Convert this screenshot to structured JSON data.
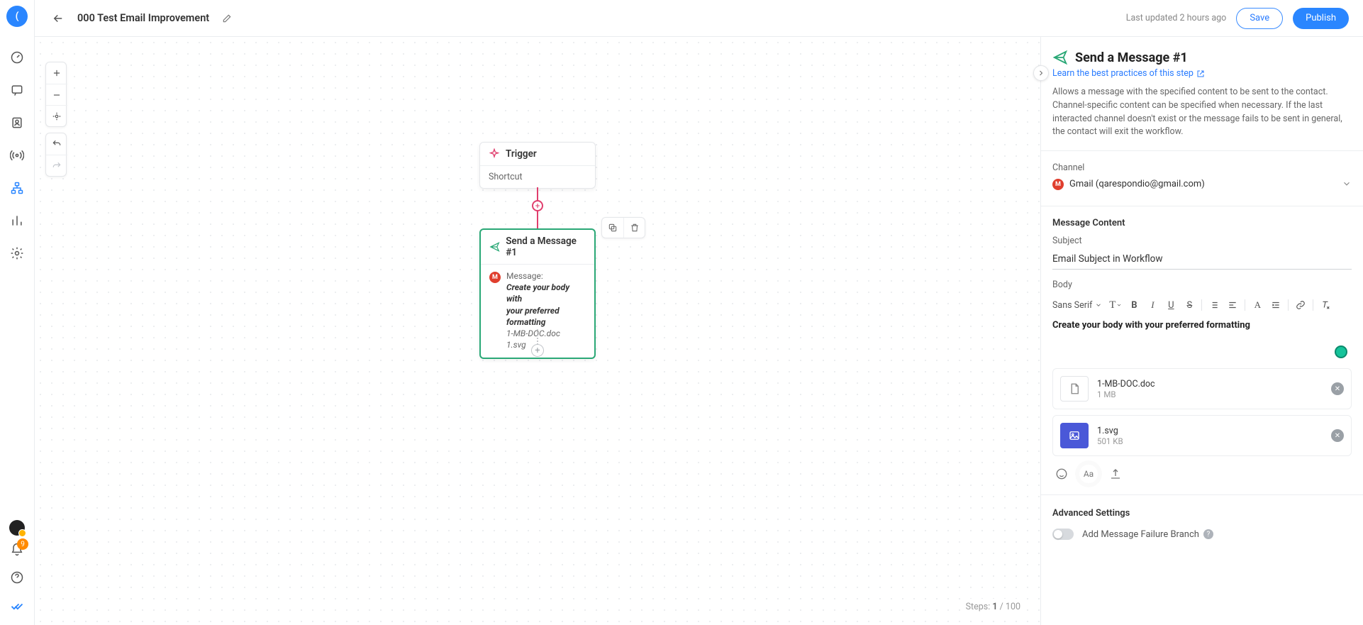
{
  "rail": {
    "avatar_initial": "(",
    "notification_count": "9"
  },
  "topbar": {
    "title": "000 Test Email Improvement",
    "last_updated": "Last updated 2 hours ago",
    "save_label": "Save",
    "publish_label": "Publish"
  },
  "canvas": {
    "steps_label": "Steps:",
    "steps_current": "1",
    "steps_sep": "/",
    "steps_max": "100",
    "trigger": {
      "title": "Trigger",
      "subtitle": "Shortcut"
    },
    "send_node": {
      "title": "Send a Message #1",
      "message_label": "Message:",
      "body_line1": "Create your body with",
      "body_line2": "your preferred formatting",
      "file1": "1-MB-DOC.doc",
      "file2": "1.svg",
      "gmail_initial": "M"
    }
  },
  "panel": {
    "title": "Send a Message #1",
    "learn_link": "Learn the best practices of this step",
    "description": "Allows a message with the specified content to be sent to the contact. Channel-specific content can be specified when necessary. If the last interacted channel doesn't exist or the message fails to be sent in general, the contact will exit the workflow.",
    "channel_label": "Channel",
    "channel_value": "Gmail (qarespondio@gmail.com)",
    "gmail_initial": "M",
    "message_content_label": "Message Content",
    "subject_label": "Subject",
    "subject_value": "Email Subject in Workflow",
    "body_label": "Body",
    "font_family": "Sans Serif",
    "body_text": "Create your body with your preferred formatting",
    "attachments": [
      {
        "name": "1-MB-DOC.doc",
        "size": "1 MB",
        "kind": "doc"
      },
      {
        "name": "1.svg",
        "size": "501 KB",
        "kind": "img"
      }
    ],
    "advanced_label": "Advanced Settings",
    "failure_branch_label": "Add Message Failure Branch"
  }
}
